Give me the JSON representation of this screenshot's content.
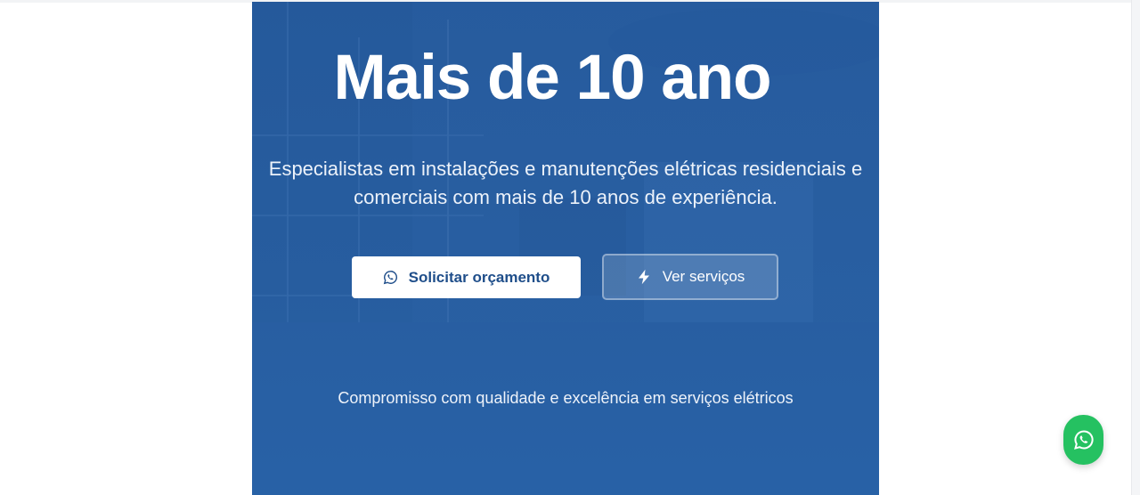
{
  "hero": {
    "title": "Mais de 10 ano",
    "subtitle": "Especialistas em instalações e manutenções elétricas residenciais e comerciais com mais de 10 anos de experiência.",
    "primary_button": {
      "label": "Solicitar orçamento",
      "icon": "whatsapp-icon"
    },
    "secondary_button": {
      "label": "Ver serviços",
      "icon": "lightning-icon"
    },
    "tagline": "Compromisso com qualidade e excelência em serviços elétricos"
  },
  "floating_button": {
    "icon": "whatsapp-icon"
  },
  "colors": {
    "hero_blue": "#2d63a6",
    "primary_button_text": "#1f4e8a",
    "whatsapp_green": "#25c161"
  }
}
